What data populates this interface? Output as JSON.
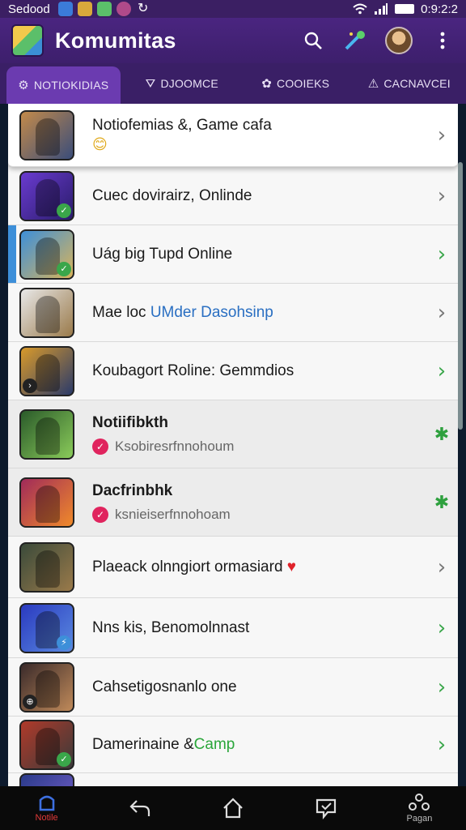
{
  "status_bar": {
    "carrier": "Sedood",
    "time": "0:9:2:2"
  },
  "app_bar": {
    "title": "Komumitas"
  },
  "tabs": [
    {
      "label": "NOTIOKIDIAS",
      "icon": "⚙",
      "active": true
    },
    {
      "label": "DJOOMCE",
      "icon": "⛛",
      "active": false
    },
    {
      "label": "COOIEKS",
      "icon": "✿",
      "active": false
    },
    {
      "label": "CACNAVCEI",
      "icon": "⚠",
      "active": false
    }
  ],
  "list": {
    "items": [
      {
        "title": "Notiofemias &, Game cafa",
        "emoji": "😊",
        "colors": [
          "#c38a4a",
          "#3a4d7a"
        ]
      },
      {
        "title": "Cuec dovirairz, Onlinde",
        "colors": [
          "#6a3bd0",
          "#2a1c6a"
        ],
        "badge": "✓",
        "badge_color": "#3aa64a"
      },
      {
        "title": "Uág big Tupd Online",
        "colors": [
          "#3d8fd9",
          "#d9b45a"
        ],
        "badge": "✓",
        "badge_color": "#3aa64a",
        "selected": true
      },
      {
        "title_plain": "Mae loc ",
        "title_accent": "UMder Dasohsinp",
        "colors": [
          "#e8e8e8",
          "#9a7a4a"
        ]
      },
      {
        "title": "Koubagort Roline: Gemmdios",
        "colors": [
          "#d99a2a",
          "#2a3a6a"
        ],
        "badge": "›",
        "badge_color": "#222"
      },
      {
        "title": "Notiifibkth",
        "subtitle": "Ksobiresrfnnohoum",
        "colors": [
          "#2a5a2a",
          "#8acb5a"
        ],
        "bold": true
      },
      {
        "title": "Dacfrinbhk",
        "subtitle": "ksnieiserfnnohoam",
        "colors": [
          "#a02a5a",
          "#f08a2a"
        ],
        "bold": true
      },
      {
        "title": "Plaeack olnngiort ormasiard",
        "heart": "♥",
        "colors": [
          "#3a4a3a",
          "#9a7a4a"
        ]
      },
      {
        "title": "Nns kis, Benomolnnast",
        "colors": [
          "#2a3ac0",
          "#5a8ae0"
        ],
        "badge": "⚡",
        "badge_color": "#3d8fd9"
      },
      {
        "title": "Cahsetigosnanlo one",
        "colors": [
          "#3a2a2a",
          "#c08a5a"
        ],
        "badge": "⊕",
        "badge_color": "#222"
      },
      {
        "title_plain": "Damerinaine &",
        "title_accent": "Camp",
        "colors": [
          "#b03a2a",
          "#3a3a3a"
        ],
        "badge": "✓",
        "badge_color": "#3aa64a"
      }
    ]
  },
  "bottom_nav": [
    {
      "label": "Notile",
      "icon": "home-outline-icon",
      "active": true
    },
    {
      "label": "",
      "icon": "back-icon"
    },
    {
      "label": "",
      "icon": "home-icon"
    },
    {
      "label": "",
      "icon": "chat-icon"
    },
    {
      "label": "Pagan",
      "icon": "network-icon"
    }
  ]
}
